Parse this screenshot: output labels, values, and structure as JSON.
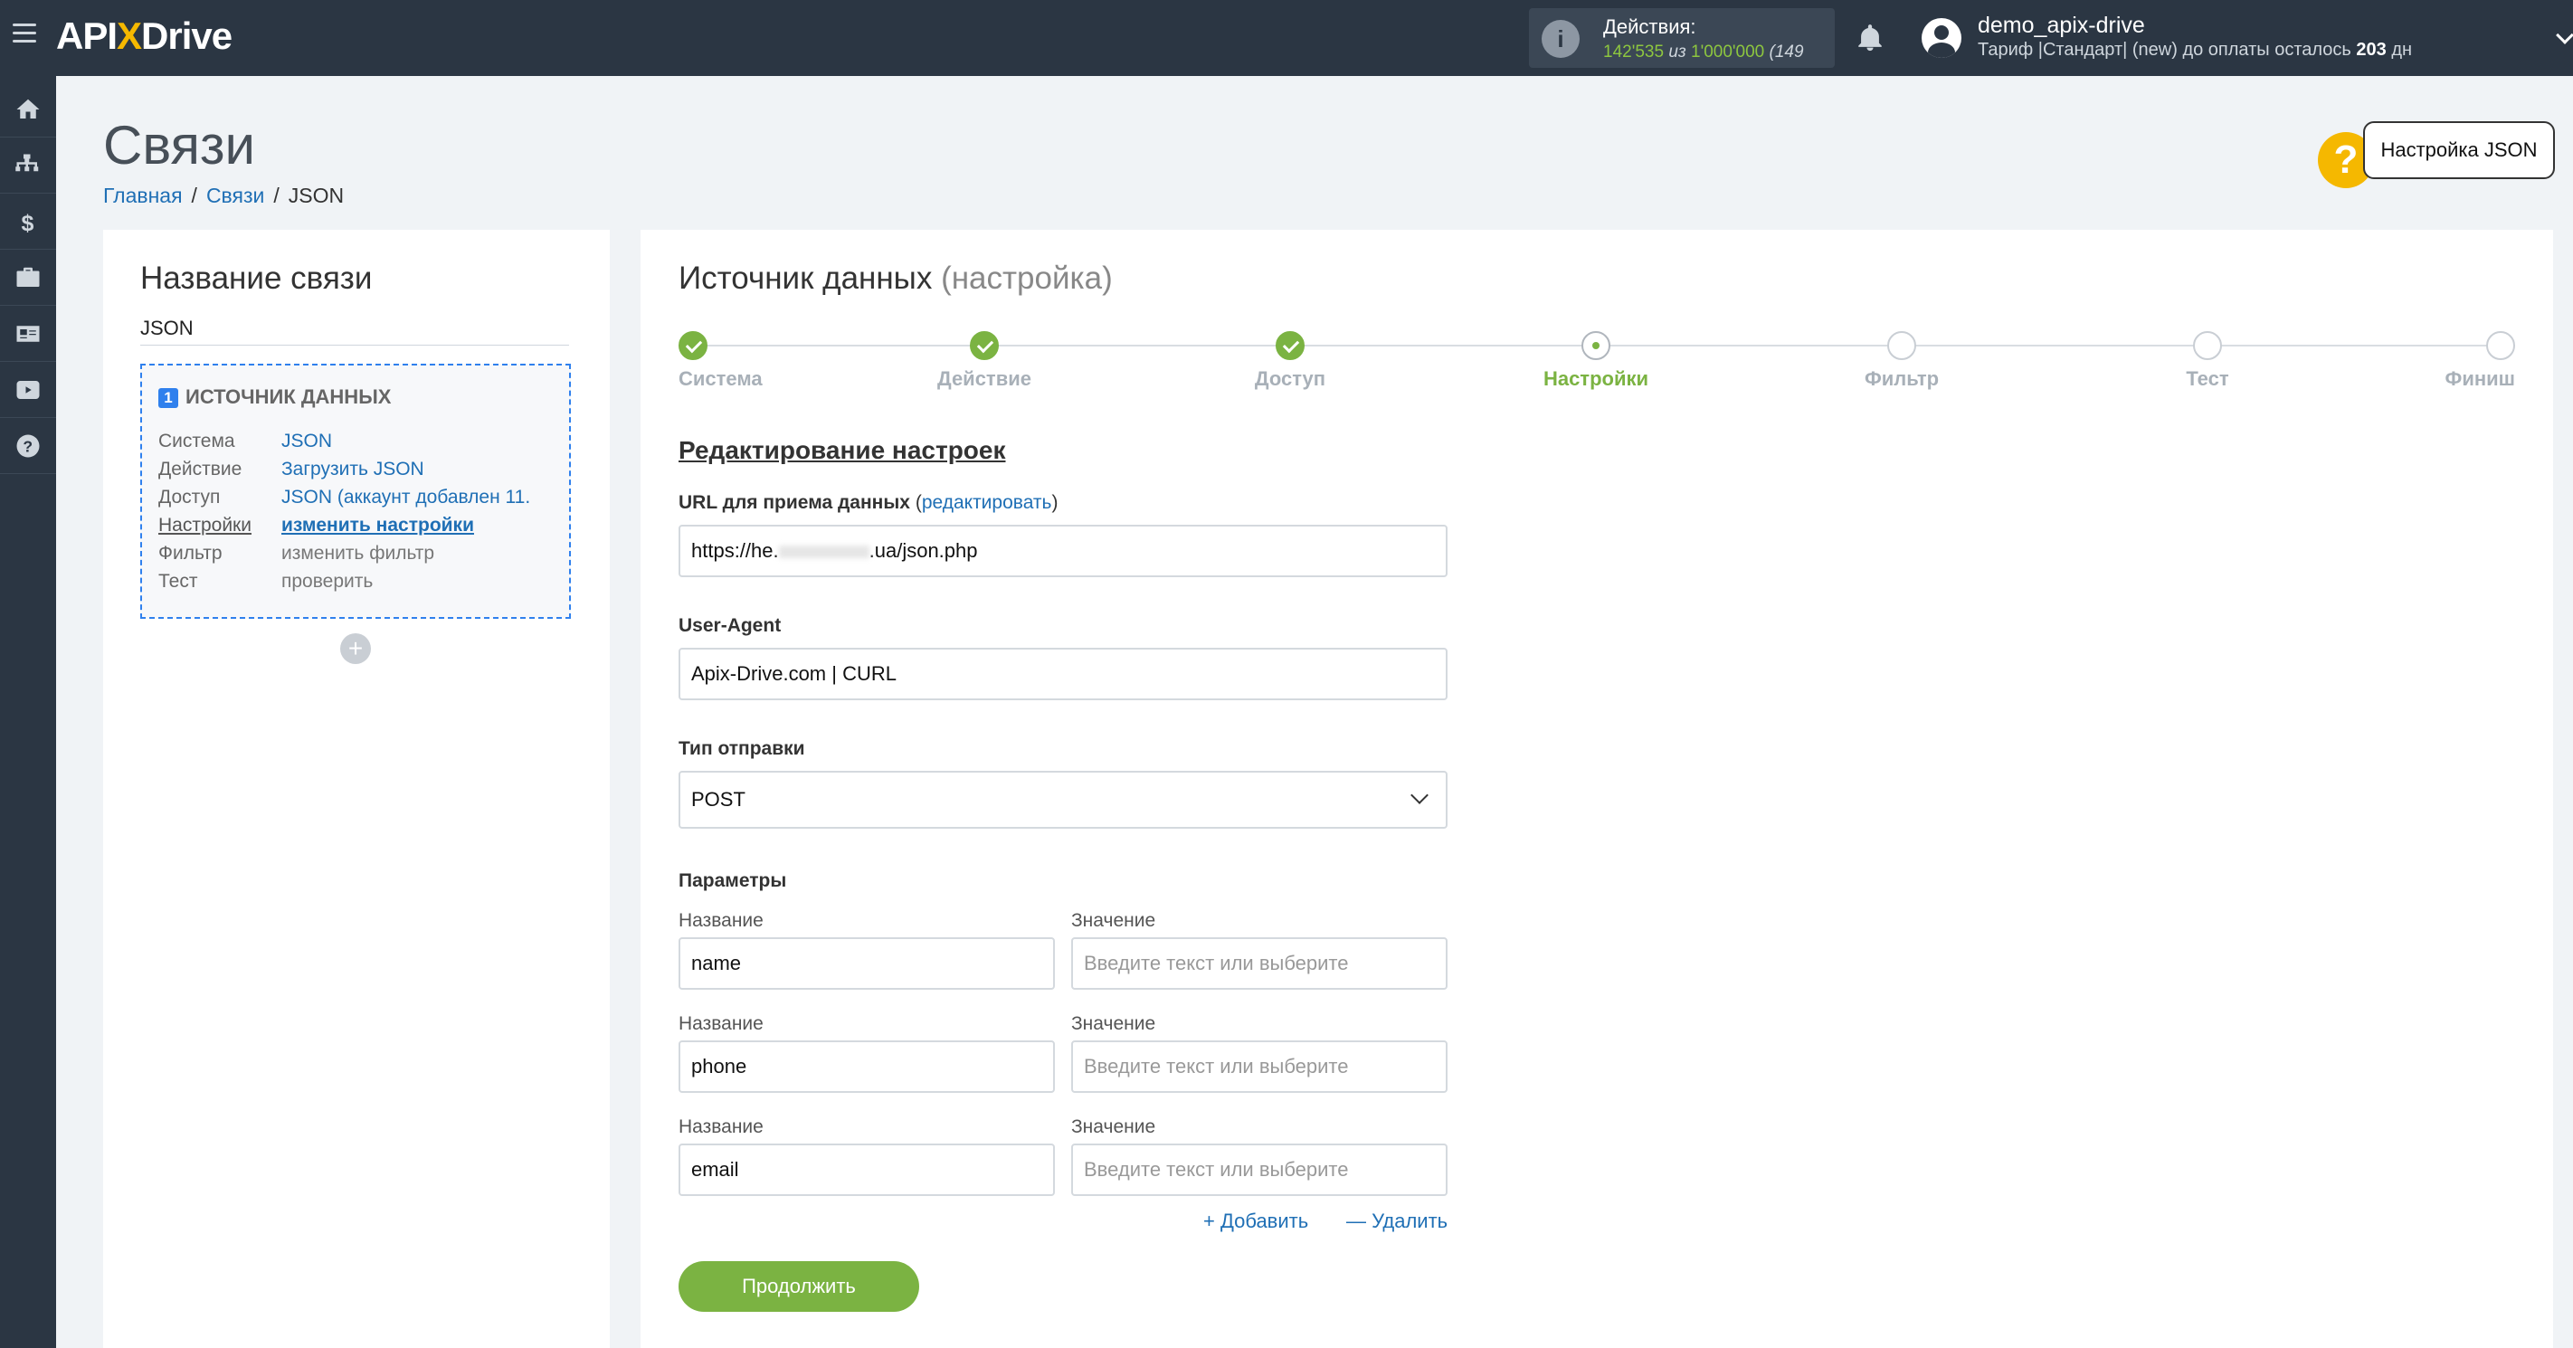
{
  "header": {
    "logo_pre": "API",
    "logo_x": "X",
    "logo_post": "Drive",
    "actions_label": "Действия:",
    "actions_used": "142'535",
    "actions_of": "из",
    "actions_total": "1'000'000",
    "actions_pct": "(149",
    "user_name": "demo_apix-drive",
    "plan_text": "Тариф |Стандарт| (new) до оплаты осталось",
    "plan_days": "203",
    "plan_unit": "дн"
  },
  "sidebar": {
    "items": [
      "home-icon",
      "sitemap-icon",
      "dollar-icon",
      "briefcase-icon",
      "id-card-icon",
      "youtube-icon",
      "help-icon"
    ]
  },
  "page": {
    "title": "Связи",
    "breadcrumb": [
      "Главная",
      "Связи",
      "JSON"
    ],
    "help_button": "Настройка JSON",
    "help_icon_text": "?"
  },
  "left": {
    "title": "Название связи",
    "name_value": "JSON",
    "source_number": "1",
    "source_header": "ИСТОЧНИК ДАННЫХ",
    "rows": [
      {
        "key": "Система",
        "value": "JSON"
      },
      {
        "key": "Действие",
        "value": "Загрузить JSON"
      },
      {
        "key": "Доступ",
        "value": "JSON (аккаунт добавлен 11."
      },
      {
        "key": "Настройки",
        "value": "изменить настройки"
      },
      {
        "key": "Фильтр",
        "value": "изменить фильтр"
      },
      {
        "key": "Тест",
        "value": "проверить"
      }
    ],
    "add_symbol": "+"
  },
  "main": {
    "title": "Источник данных",
    "title_sub": "(настройка)",
    "steps": [
      {
        "label": "Система",
        "state": "done"
      },
      {
        "label": "Действие",
        "state": "done"
      },
      {
        "label": "Доступ",
        "state": "done"
      },
      {
        "label": "Настройки",
        "state": "active"
      },
      {
        "label": "Фильтр",
        "state": "todo"
      },
      {
        "label": "Тест",
        "state": "todo"
      },
      {
        "label": "Финиш",
        "state": "todo"
      }
    ],
    "section_title": "Редактирование настроек",
    "url_label": "URL для приема данных",
    "url_edit": "редактировать",
    "url_prefix": "https://he.",
    "url_suffix": ".ua/json.php",
    "ua_label": "User-Agent",
    "ua_value": "Apix-Drive.com | CURL",
    "send_type_label": "Тип отправки",
    "send_type_value": "POST",
    "params_label": "Параметры",
    "param_name_label": "Название",
    "param_value_label": "Значение",
    "value_placeholder": "Введите текст или выберите",
    "params": [
      "name",
      "phone",
      "email"
    ],
    "add_label": "+ Добавить",
    "remove_label": "— Удалить",
    "continue_label": "Продолжить"
  },
  "colors": {
    "topbar": "#2b3643",
    "accent_green": "#7bb342",
    "link_blue": "#1f6fb5",
    "logo_x": "#f5b800"
  }
}
